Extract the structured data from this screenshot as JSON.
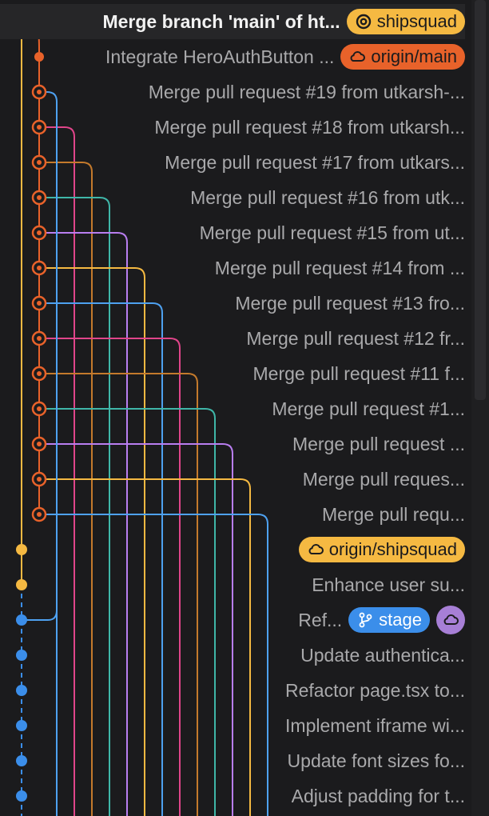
{
  "colors": {
    "background": "#1b1b1d",
    "main_lane": "#f5b942",
    "origin_lane": "#e8622a",
    "stage_lane": "#3b8eea",
    "branch_palette": [
      "#4ea1f0",
      "#e0458a",
      "#c47a2c",
      "#3fb6a8",
      "#b97ef0",
      "#f5b942"
    ]
  },
  "commits": [
    {
      "message": "Merge branch 'main' of ht...",
      "refs": [
        {
          "type": "local",
          "label": "shipsquad"
        }
      ]
    },
    {
      "message": "Integrate HeroAuthButton ...",
      "refs": [
        {
          "type": "remote",
          "label": "origin/main"
        }
      ]
    },
    {
      "message": "Merge pull request #19 from utkarsh-...",
      "refs": []
    },
    {
      "message": "Merge pull request #18 from utkarsh...",
      "refs": []
    },
    {
      "message": "Merge pull request #17 from utkars...",
      "refs": []
    },
    {
      "message": "Merge pull request #16 from utk...",
      "refs": []
    },
    {
      "message": "Merge pull request #15 from ut...",
      "refs": []
    },
    {
      "message": "Merge pull request #14 from ...",
      "refs": []
    },
    {
      "message": "Merge pull request #13 fro...",
      "refs": []
    },
    {
      "message": "Merge pull request #12 fr...",
      "refs": []
    },
    {
      "message": "Merge pull request #11 f...",
      "refs": []
    },
    {
      "message": "Merge pull request #1...",
      "refs": []
    },
    {
      "message": "Merge pull request ...",
      "refs": []
    },
    {
      "message": "Merge pull reques...",
      "refs": []
    },
    {
      "message": "Merge pull requ...",
      "refs": []
    },
    {
      "message": "",
      "refs": [
        {
          "type": "remote",
          "label": "origin/shipsquad"
        }
      ]
    },
    {
      "message": "Enhance user su...",
      "refs": []
    },
    {
      "message": "Ref...",
      "refs": [
        {
          "type": "branch",
          "label": "stage"
        },
        {
          "type": "cloud",
          "label": ""
        }
      ]
    },
    {
      "message": "Update authentica...",
      "refs": []
    },
    {
      "message": "Refactor page.tsx to...",
      "refs": []
    },
    {
      "message": "Implement iframe wi...",
      "refs": []
    },
    {
      "message": "Update font sizes fo...",
      "refs": []
    },
    {
      "message": "Adjust padding for t...",
      "refs": []
    }
  ]
}
